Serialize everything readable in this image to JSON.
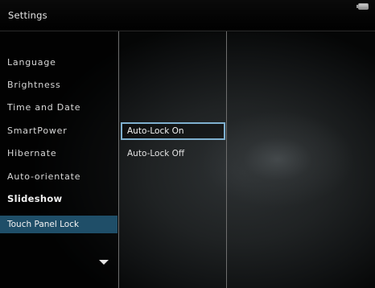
{
  "header": {
    "title": "Settings",
    "status_icon": "battery-icon"
  },
  "menu": {
    "items": [
      {
        "label": "Language"
      },
      {
        "label": "Brightness"
      },
      {
        "label": "Time and Date"
      },
      {
        "label": "SmartPower"
      },
      {
        "label": "Hibernate"
      },
      {
        "label": "Auto-orientate"
      },
      {
        "label": "Slideshow"
      },
      {
        "label": "Touch Panel Lock",
        "selected": true
      }
    ],
    "scroll_icon": "triangle-down-icon"
  },
  "submenu": {
    "options": [
      {
        "label": "Auto-Lock On",
        "focused": true
      },
      {
        "label": "Auto-Lock Off"
      }
    ]
  },
  "colors": {
    "selection_bg": "#1f4e68",
    "focus_border": "#7fb0cf"
  }
}
